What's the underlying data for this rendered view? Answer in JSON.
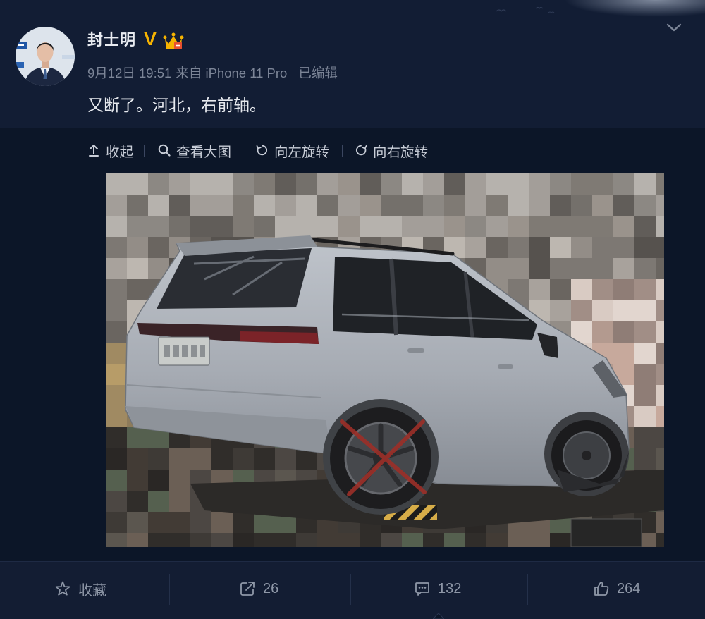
{
  "post": {
    "author_name": "封士明",
    "verified_badge": "V",
    "date_time": "9月12日 19:51",
    "source": "来自 iPhone 11 Pro",
    "edited": "已编辑",
    "text": "又断了。河北，右前轴。"
  },
  "toolbar": {
    "collapse": {
      "label": "收起",
      "icon": "collapse-icon"
    },
    "view_large": {
      "label": "查看大图",
      "icon": "search-icon"
    },
    "rotate_left": {
      "label": "向左旋转",
      "icon": "rotate-left-icon"
    },
    "rotate_right": {
      "label": "向右旋转",
      "icon": "rotate-right-icon"
    }
  },
  "actions": {
    "favorite": {
      "label": "收藏",
      "icon": "star-icon"
    },
    "repost": {
      "count": "26",
      "icon": "share-icon"
    },
    "comment": {
      "count": "132",
      "icon": "comment-icon"
    },
    "like": {
      "count": "264",
      "icon": "thumbs-up-icon"
    }
  },
  "icons": {
    "menu": "chevron-down-icon",
    "verified": "verified-v-icon",
    "member": "vip-crown-icon",
    "avatar": "avatar"
  },
  "colors": {
    "background": "#121d34",
    "image_area": "#0c1628",
    "action_bar": "#131d33",
    "text_primary": "#e6e9ee",
    "text_secondary": "#7c8597",
    "verified": "#f5b301"
  }
}
